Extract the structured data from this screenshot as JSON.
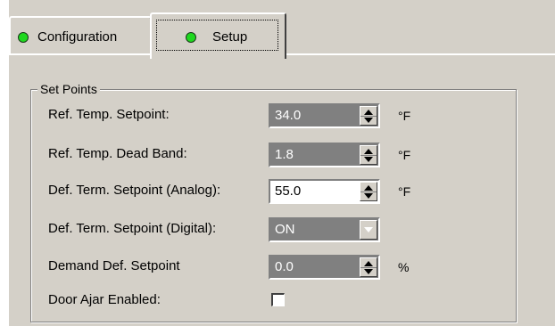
{
  "tabs": [
    {
      "label": "Configuration",
      "status_color": "#1fd81f",
      "active": false
    },
    {
      "label": "Setup",
      "status_color": "#1fd81f",
      "active": true
    }
  ],
  "set_points": {
    "title": "Set Points",
    "rows": [
      {
        "label": "Ref. Temp. Setpoint:",
        "value": "34.0",
        "unit": "°F",
        "control": "spin",
        "enabled": false
      },
      {
        "label": "Ref. Temp. Dead Band:",
        "value": "1.8",
        "unit": "°F",
        "control": "spin",
        "enabled": false
      },
      {
        "label": "Def. Term. Setpoint (Analog):",
        "value": "55.0",
        "unit": "°F",
        "control": "spin",
        "enabled": true
      },
      {
        "label": "Def. Term. Setpoint (Digital):",
        "value": "ON",
        "unit": "",
        "control": "combo",
        "enabled": false
      },
      {
        "label": "Demand Def. Setpoint",
        "value": "0.0",
        "unit": "%",
        "control": "spin",
        "enabled": false
      }
    ],
    "door_ajar": {
      "label": "Door Ajar Enabled:",
      "checked": false
    }
  }
}
